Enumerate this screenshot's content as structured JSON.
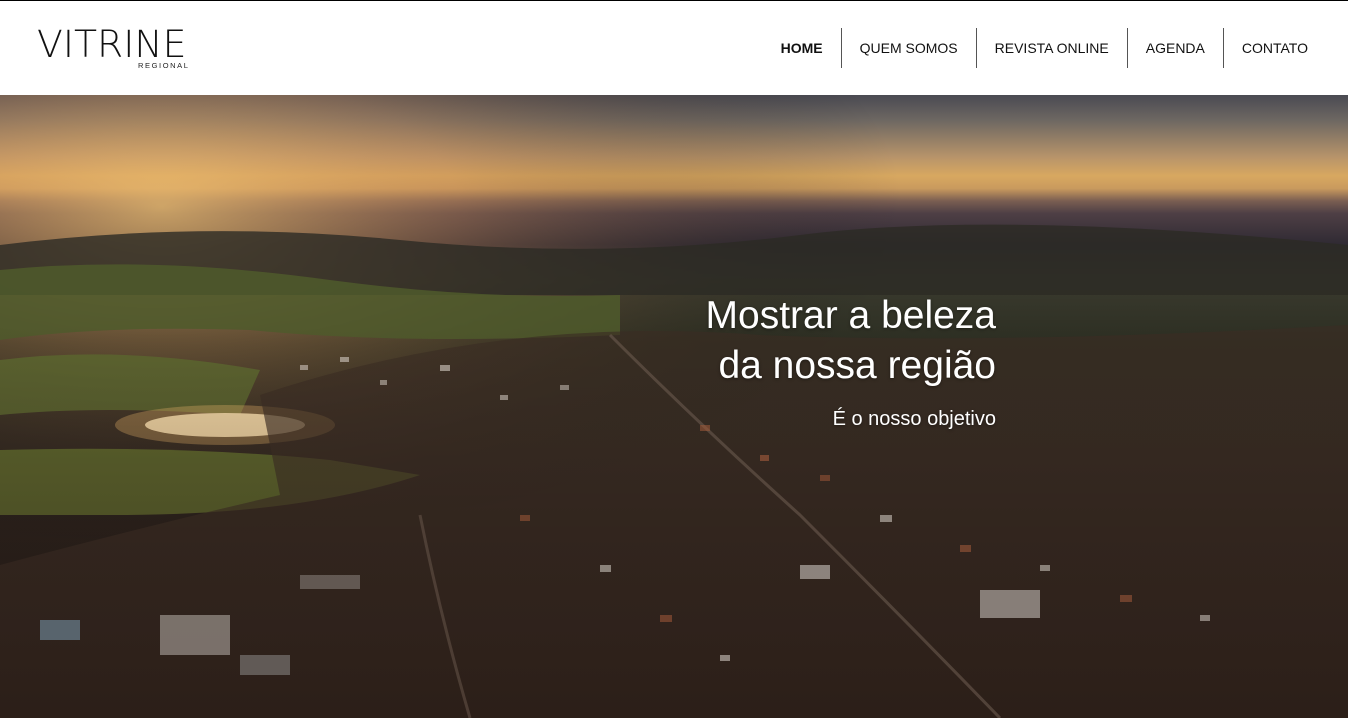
{
  "brand": {
    "name": "VITRINE",
    "sub": "REGIONAL"
  },
  "nav": {
    "items": [
      {
        "label": "HOME",
        "active": true
      },
      {
        "label": "QUEM SOMOS"
      },
      {
        "label": "REVISTA ONLINE"
      },
      {
        "label": "AGENDA"
      },
      {
        "label": "CONTATO"
      }
    ]
  },
  "hero": {
    "title_line1": "Mostrar a beleza",
    "title_line2": "da nossa região",
    "subtitle": "É o nosso objetivo",
    "image": "aerial-city-sunset-photo"
  },
  "colors": {
    "header_bg": "#ffffff",
    "text_dark": "#111111",
    "hero_text": "#ffffff"
  }
}
